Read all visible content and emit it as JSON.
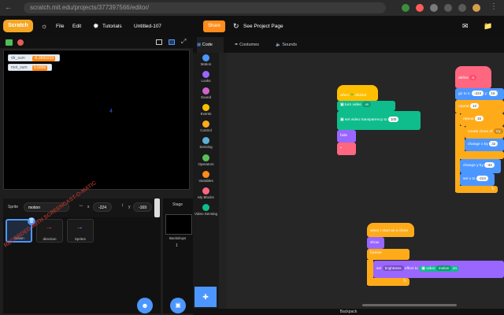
{
  "browser": {
    "url_text": "scratch.mit.edu/projects/377397566/editor/"
  },
  "menubar": {
    "logo": "Scratch",
    "file": "File",
    "edit": "Edit",
    "tutorials": "Tutorials",
    "project_title": "Untitled-107",
    "share": "Share",
    "see_project_page": "See Project Page"
  },
  "monitors": [
    {
      "label": "dir_sum",
      "value": "-6.3660233"
    },
    {
      "label": "mot_sum",
      "value": "0.5866"
    }
  ],
  "stage_marker": "4",
  "sprite_info": {
    "sprite_label": "Sprite",
    "sprite_name": "motion",
    "x_label": "x",
    "x_value": "-224",
    "y_label": "y",
    "y_value": "-169"
  },
  "sprites": [
    {
      "name": "motion"
    },
    {
      "name": "direction"
    },
    {
      "name": "Sprite1"
    }
  ],
  "stage_pane": {
    "label": "Stage",
    "backdrops_label": "Backdrops",
    "backdrops_count": "1"
  },
  "tabs": {
    "code": "Code",
    "costumes": "Costumes",
    "sounds": "Sounds"
  },
  "categories": [
    {
      "label": "Motion",
      "color": "#4c97ff"
    },
    {
      "label": "Looks",
      "color": "#9966ff"
    },
    {
      "label": "Sound",
      "color": "#cf63cf"
    },
    {
      "label": "Events",
      "color": "#ffbf00"
    },
    {
      "label": "Control",
      "color": "#ffab19"
    },
    {
      "label": "Sensing",
      "color": "#5cb1d6"
    },
    {
      "label": "Operators",
      "color": "#59c059"
    },
    {
      "label": "Variables",
      "color": "#ff8c1a"
    },
    {
      "label": "My Blocks",
      "color": "#ff6680"
    },
    {
      "label": "Video Sensing",
      "color": "#0fbd8c"
    }
  ],
  "scripts": {
    "s1": {
      "hat": "when",
      "hat2": "clicked",
      "turn_video": "turn video",
      "turn_video_val": "on",
      "set_transp": "set video transparency to",
      "set_transp_val": "100",
      "hide": "hide"
    },
    "s2": {
      "hat": "when I start as a clone",
      "show": "show",
      "forever": "forever",
      "set": "set",
      "set_effect": "brightness",
      "effect_to": "effect to",
      "video_label": "video",
      "video_field": "motion",
      "on_label": "on"
    },
    "s3": {
      "define": "define",
      "go_to": "go to x:",
      "go_x": "-224",
      "go_y_label": "y:",
      "go_y": "16",
      "repeat": "repeat",
      "repeat_val": "12",
      "repeat2": "repeat",
      "repeat2_val": "15",
      "create_clone": "create clone of",
      "create_clone_val": "my",
      "change_x": "change x by",
      "change_x_val": "32",
      "change_y": "change y by",
      "change_y_val": "-32",
      "set_x": "set x to",
      "set_x_val": "-224"
    }
  },
  "bottom_bar": "Backpack",
  "watermark": "RECORDED WITH SCREENCAST-O-MATIC"
}
